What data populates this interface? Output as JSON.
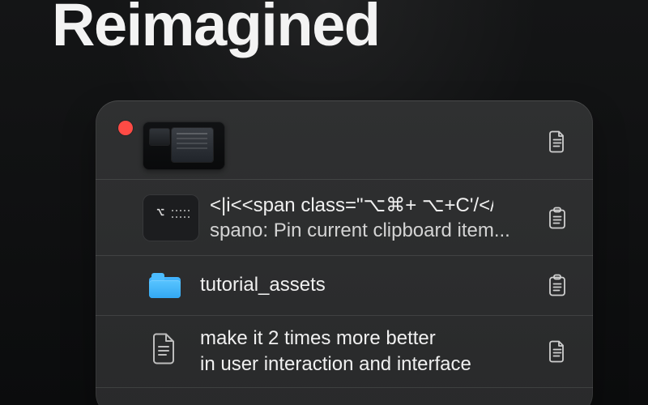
{
  "hero": {
    "title": "Reimagined"
  },
  "window": {
    "close_color": "#ff4b45",
    "items": [
      {
        "type": "screenshot",
        "action_icon": "document-icon"
      },
      {
        "type": "code",
        "thumbnail_glyph": "⌥",
        "line_1": "<|i<<span class=\"⌥⌘+ ⌥+C'/</>",
        "line_2": "spano: Pin current clipboard item...",
        "action_icon": "clipboard-icon"
      },
      {
        "type": "folder",
        "label": "tutorial_assets",
        "folder_color": "#3aaef7",
        "action_icon": "clipboard-icon"
      },
      {
        "type": "text",
        "line_1": "make it 2 times more better",
        "line_2": "in user interaction and interface",
        "action_icon": "document-icon"
      },
      {
        "type": "text",
        "partial_line": ""
      }
    ]
  }
}
